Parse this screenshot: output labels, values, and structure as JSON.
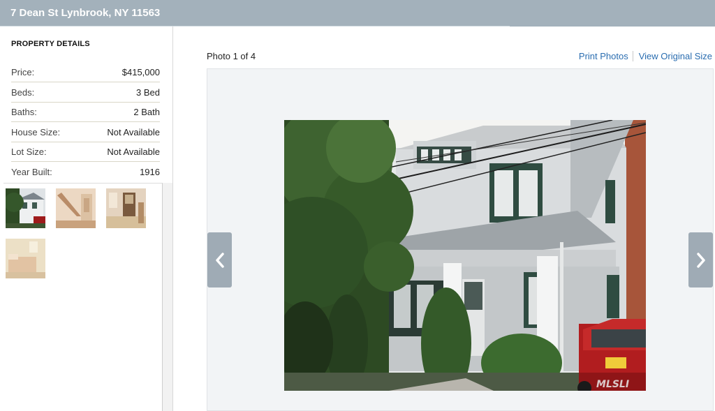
{
  "header": {
    "title": "7 Dean St Lynbrook, NY 11563"
  },
  "details": {
    "heading": "PROPERTY DETAILS",
    "rows": [
      {
        "label": "Price:",
        "value": "$415,000"
      },
      {
        "label": "Beds:",
        "value": "3 Bed"
      },
      {
        "label": "Baths:",
        "value": "2 Bath"
      },
      {
        "label": "House Size:",
        "value": "Not Available"
      },
      {
        "label": "Lot Size:",
        "value": "Not Available"
      },
      {
        "label": "Year Built:",
        "value": "1916"
      }
    ]
  },
  "thumbnails": [
    {
      "name": "house-exterior"
    },
    {
      "name": "interior-staircase"
    },
    {
      "name": "interior-room"
    },
    {
      "name": "bedroom"
    }
  ],
  "viewer": {
    "photo_counter": "Photo 1 of 4",
    "print_link": "Print Photos",
    "original_link": "View Original Size",
    "watermark": "MLSLI",
    "prev_icon": "chevron-left-icon",
    "next_icon": "chevron-right-icon"
  },
  "colors": {
    "title_bar": "#a3b1bb",
    "link": "#2a6db0",
    "nav_button": "#9fabb5"
  }
}
